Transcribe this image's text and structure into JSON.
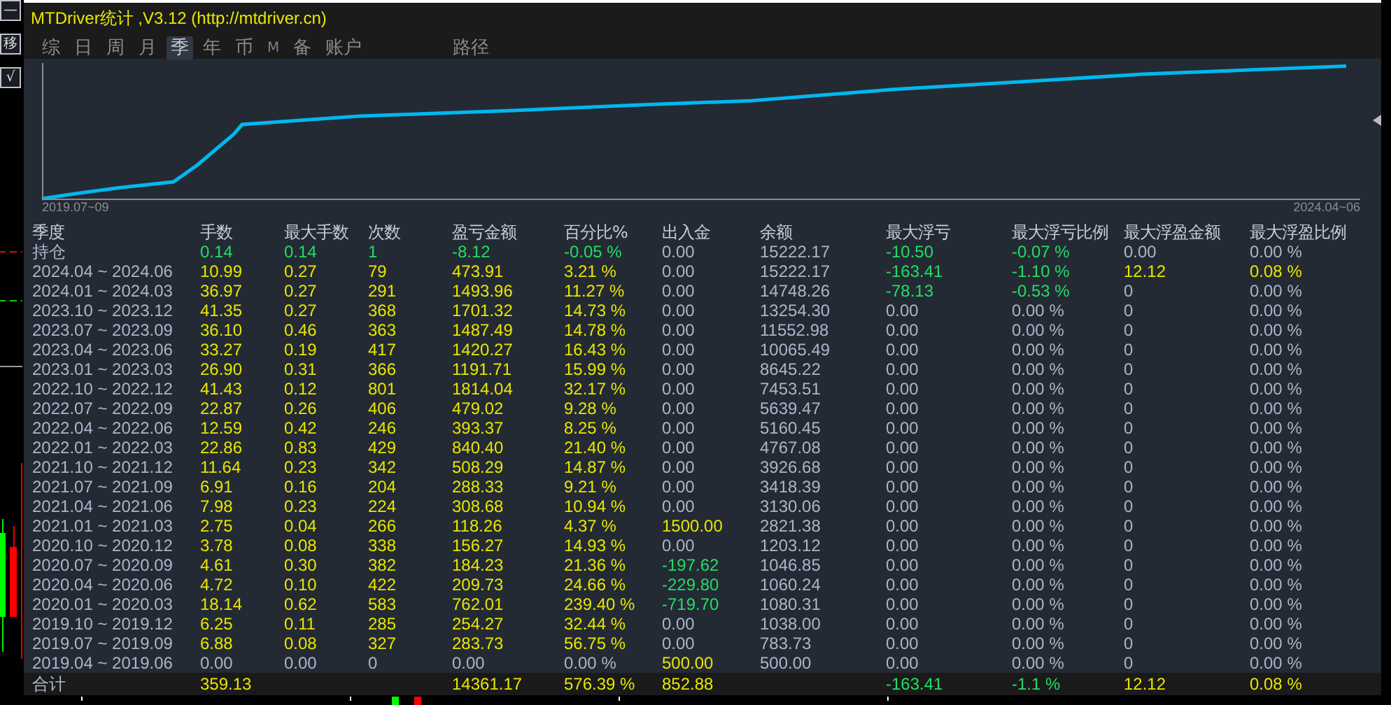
{
  "side_buttons": [
    "—",
    "移",
    "√"
  ],
  "window": {
    "title": "MTDriver统计 ,V3.12 (http://mtdriver.cn)"
  },
  "tabs": [
    {
      "label": "综",
      "selected": false
    },
    {
      "label": "日",
      "selected": false
    },
    {
      "label": "周",
      "selected": false
    },
    {
      "label": "月",
      "selected": false
    },
    {
      "label": "季",
      "selected": true
    },
    {
      "label": "年",
      "selected": false
    },
    {
      "label": "币",
      "selected": false
    },
    {
      "label": "M",
      "selected": false
    },
    {
      "label": "备",
      "selected": false
    },
    {
      "label": "账户",
      "selected": false
    },
    {
      "label": "路径",
      "selected": false
    }
  ],
  "equity_chart": {
    "start_label": "2019.07~09",
    "end_label": "2024.04~06"
  },
  "table": {
    "columns": [
      "季度",
      "手数",
      "最大手数",
      "次数",
      "盈亏金额",
      "百分比%",
      "出入金",
      "余额",
      "最大浮亏",
      "最大浮亏比例",
      "最大浮盈金额",
      "最大浮盈比例"
    ],
    "rows": [
      {
        "cells": [
          {
            "text": "持仓",
            "color": "#a9b6cc"
          },
          {
            "text": "0.14",
            "color": "#22dd66"
          },
          {
            "text": "0.14",
            "color": "#22dd66"
          },
          {
            "text": "1",
            "color": "#22dd66"
          },
          {
            "text": "-8.12",
            "color": "#22dd66"
          },
          {
            "text": "-0.05 %",
            "color": "#22dd66"
          },
          {
            "text": "0.00",
            "color": "#a9b6cc"
          },
          {
            "text": "15222.17",
            "color": "#a9b6cc"
          },
          {
            "text": "-10.50",
            "color": "#22dd66"
          },
          {
            "text": "-0.07 %",
            "color": "#22dd66"
          },
          {
            "text": "0.00",
            "color": "#a9b6cc"
          },
          {
            "text": "0.00 %",
            "color": "#a9b6cc"
          }
        ]
      },
      {
        "cells": [
          {
            "text": "2024.04 ~ 2024.06",
            "color": "#a9b6cc"
          },
          {
            "text": "10.99",
            "color": "#e6e600"
          },
          {
            "text": "0.27",
            "color": "#e6e600"
          },
          {
            "text": "79",
            "color": "#e6e600"
          },
          {
            "text": "473.91",
            "color": "#e6e600"
          },
          {
            "text": "3.21 %",
            "color": "#e6e600"
          },
          {
            "text": "0.00",
            "color": "#a9b6cc"
          },
          {
            "text": "15222.17",
            "color": "#a9b6cc"
          },
          {
            "text": "-163.41",
            "color": "#22dd66"
          },
          {
            "text": "-1.10 %",
            "color": "#22dd66"
          },
          {
            "text": "12.12",
            "color": "#e6e600"
          },
          {
            "text": "0.08 %",
            "color": "#e6e600"
          }
        ]
      },
      {
        "cells": [
          {
            "text": "2024.01 ~ 2024.03",
            "color": "#a9b6cc"
          },
          {
            "text": "36.97",
            "color": "#e6e600"
          },
          {
            "text": "0.27",
            "color": "#e6e600"
          },
          {
            "text": "291",
            "color": "#e6e600"
          },
          {
            "text": "1493.96",
            "color": "#e6e600"
          },
          {
            "text": "11.27 %",
            "color": "#e6e600"
          },
          {
            "text": "0.00",
            "color": "#a9b6cc"
          },
          {
            "text": "14748.26",
            "color": "#a9b6cc"
          },
          {
            "text": "-78.13",
            "color": "#22dd66"
          },
          {
            "text": "-0.53 %",
            "color": "#22dd66"
          },
          {
            "text": "0",
            "color": "#a9b6cc"
          },
          {
            "text": "0.00 %",
            "color": "#a9b6cc"
          }
        ]
      },
      {
        "cells": [
          {
            "text": "2023.10 ~ 2023.12",
            "color": "#a9b6cc"
          },
          {
            "text": "41.35",
            "color": "#e6e600"
          },
          {
            "text": "0.27",
            "color": "#e6e600"
          },
          {
            "text": "368",
            "color": "#e6e600"
          },
          {
            "text": "1701.32",
            "color": "#e6e600"
          },
          {
            "text": "14.73 %",
            "color": "#e6e600"
          },
          {
            "text": "0.00",
            "color": "#a9b6cc"
          },
          {
            "text": "13254.30",
            "color": "#a9b6cc"
          },
          {
            "text": "0.00",
            "color": "#a9b6cc"
          },
          {
            "text": "0.00 %",
            "color": "#a9b6cc"
          },
          {
            "text": "0",
            "color": "#a9b6cc"
          },
          {
            "text": "0.00 %",
            "color": "#a9b6cc"
          }
        ]
      },
      {
        "cells": [
          {
            "text": "2023.07 ~ 2023.09",
            "color": "#a9b6cc"
          },
          {
            "text": "36.10",
            "color": "#e6e600"
          },
          {
            "text": "0.46",
            "color": "#e6e600"
          },
          {
            "text": "363",
            "color": "#e6e600"
          },
          {
            "text": "1487.49",
            "color": "#e6e600"
          },
          {
            "text": "14.78 %",
            "color": "#e6e600"
          },
          {
            "text": "0.00",
            "color": "#a9b6cc"
          },
          {
            "text": "11552.98",
            "color": "#a9b6cc"
          },
          {
            "text": "0.00",
            "color": "#a9b6cc"
          },
          {
            "text": "0.00 %",
            "color": "#a9b6cc"
          },
          {
            "text": "0",
            "color": "#a9b6cc"
          },
          {
            "text": "0.00 %",
            "color": "#a9b6cc"
          }
        ]
      },
      {
        "cells": [
          {
            "text": "2023.04 ~ 2023.06",
            "color": "#a9b6cc"
          },
          {
            "text": "33.27",
            "color": "#e6e600"
          },
          {
            "text": "0.19",
            "color": "#e6e600"
          },
          {
            "text": "417",
            "color": "#e6e600"
          },
          {
            "text": "1420.27",
            "color": "#e6e600"
          },
          {
            "text": "16.43 %",
            "color": "#e6e600"
          },
          {
            "text": "0.00",
            "color": "#a9b6cc"
          },
          {
            "text": "10065.49",
            "color": "#a9b6cc"
          },
          {
            "text": "0.00",
            "color": "#a9b6cc"
          },
          {
            "text": "0.00 %",
            "color": "#a9b6cc"
          },
          {
            "text": "0",
            "color": "#a9b6cc"
          },
          {
            "text": "0.00 %",
            "color": "#a9b6cc"
          }
        ]
      },
      {
        "cells": [
          {
            "text": "2023.01 ~ 2023.03",
            "color": "#a9b6cc"
          },
          {
            "text": "26.90",
            "color": "#e6e600"
          },
          {
            "text": "0.31",
            "color": "#e6e600"
          },
          {
            "text": "366",
            "color": "#e6e600"
          },
          {
            "text": "1191.71",
            "color": "#e6e600"
          },
          {
            "text": "15.99 %",
            "color": "#e6e600"
          },
          {
            "text": "0.00",
            "color": "#a9b6cc"
          },
          {
            "text": "8645.22",
            "color": "#a9b6cc"
          },
          {
            "text": "0.00",
            "color": "#a9b6cc"
          },
          {
            "text": "0.00 %",
            "color": "#a9b6cc"
          },
          {
            "text": "0",
            "color": "#a9b6cc"
          },
          {
            "text": "0.00 %",
            "color": "#a9b6cc"
          }
        ]
      },
      {
        "cells": [
          {
            "text": "2022.10 ~ 2022.12",
            "color": "#a9b6cc"
          },
          {
            "text": "41.43",
            "color": "#e6e600"
          },
          {
            "text": "0.12",
            "color": "#e6e600"
          },
          {
            "text": "801",
            "color": "#e6e600"
          },
          {
            "text": "1814.04",
            "color": "#e6e600"
          },
          {
            "text": "32.17 %",
            "color": "#e6e600"
          },
          {
            "text": "0.00",
            "color": "#a9b6cc"
          },
          {
            "text": "7453.51",
            "color": "#a9b6cc"
          },
          {
            "text": "0.00",
            "color": "#a9b6cc"
          },
          {
            "text": "0.00 %",
            "color": "#a9b6cc"
          },
          {
            "text": "0",
            "color": "#a9b6cc"
          },
          {
            "text": "0.00 %",
            "color": "#a9b6cc"
          }
        ]
      },
      {
        "cells": [
          {
            "text": "2022.07 ~ 2022.09",
            "color": "#a9b6cc"
          },
          {
            "text": "22.87",
            "color": "#e6e600"
          },
          {
            "text": "0.26",
            "color": "#e6e600"
          },
          {
            "text": "406",
            "color": "#e6e600"
          },
          {
            "text": "479.02",
            "color": "#e6e600"
          },
          {
            "text": "9.28 %",
            "color": "#e6e600"
          },
          {
            "text": "0.00",
            "color": "#a9b6cc"
          },
          {
            "text": "5639.47",
            "color": "#a9b6cc"
          },
          {
            "text": "0.00",
            "color": "#a9b6cc"
          },
          {
            "text": "0.00 %",
            "color": "#a9b6cc"
          },
          {
            "text": "0",
            "color": "#a9b6cc"
          },
          {
            "text": "0.00 %",
            "color": "#a9b6cc"
          }
        ]
      },
      {
        "cells": [
          {
            "text": "2022.04 ~ 2022.06",
            "color": "#a9b6cc"
          },
          {
            "text": "12.59",
            "color": "#e6e600"
          },
          {
            "text": "0.42",
            "color": "#e6e600"
          },
          {
            "text": "246",
            "color": "#e6e600"
          },
          {
            "text": "393.37",
            "color": "#e6e600"
          },
          {
            "text": "8.25 %",
            "color": "#e6e600"
          },
          {
            "text": "0.00",
            "color": "#a9b6cc"
          },
          {
            "text": "5160.45",
            "color": "#a9b6cc"
          },
          {
            "text": "0.00",
            "color": "#a9b6cc"
          },
          {
            "text": "0.00 %",
            "color": "#a9b6cc"
          },
          {
            "text": "0",
            "color": "#a9b6cc"
          },
          {
            "text": "0.00 %",
            "color": "#a9b6cc"
          }
        ]
      },
      {
        "cells": [
          {
            "text": "2022.01 ~ 2022.03",
            "color": "#a9b6cc"
          },
          {
            "text": "22.86",
            "color": "#e6e600"
          },
          {
            "text": "0.83",
            "color": "#e6e600"
          },
          {
            "text": "429",
            "color": "#e6e600"
          },
          {
            "text": "840.40",
            "color": "#e6e600"
          },
          {
            "text": "21.40 %",
            "color": "#e6e600"
          },
          {
            "text": "0.00",
            "color": "#a9b6cc"
          },
          {
            "text": "4767.08",
            "color": "#a9b6cc"
          },
          {
            "text": "0.00",
            "color": "#a9b6cc"
          },
          {
            "text": "0.00 %",
            "color": "#a9b6cc"
          },
          {
            "text": "0",
            "color": "#a9b6cc"
          },
          {
            "text": "0.00 %",
            "color": "#a9b6cc"
          }
        ]
      },
      {
        "cells": [
          {
            "text": "2021.10 ~ 2021.12",
            "color": "#a9b6cc"
          },
          {
            "text": "11.64",
            "color": "#e6e600"
          },
          {
            "text": "0.23",
            "color": "#e6e600"
          },
          {
            "text": "342",
            "color": "#e6e600"
          },
          {
            "text": "508.29",
            "color": "#e6e600"
          },
          {
            "text": "14.87 %",
            "color": "#e6e600"
          },
          {
            "text": "0.00",
            "color": "#a9b6cc"
          },
          {
            "text": "3926.68",
            "color": "#a9b6cc"
          },
          {
            "text": "0.00",
            "color": "#a9b6cc"
          },
          {
            "text": "0.00 %",
            "color": "#a9b6cc"
          },
          {
            "text": "0",
            "color": "#a9b6cc"
          },
          {
            "text": "0.00 %",
            "color": "#a9b6cc"
          }
        ]
      },
      {
        "cells": [
          {
            "text": "2021.07 ~ 2021.09",
            "color": "#a9b6cc"
          },
          {
            "text": "6.91",
            "color": "#e6e600"
          },
          {
            "text": "0.16",
            "color": "#e6e600"
          },
          {
            "text": "204",
            "color": "#e6e600"
          },
          {
            "text": "288.33",
            "color": "#e6e600"
          },
          {
            "text": "9.21 %",
            "color": "#e6e600"
          },
          {
            "text": "0.00",
            "color": "#a9b6cc"
          },
          {
            "text": "3418.39",
            "color": "#a9b6cc"
          },
          {
            "text": "0.00",
            "color": "#a9b6cc"
          },
          {
            "text": "0.00 %",
            "color": "#a9b6cc"
          },
          {
            "text": "0",
            "color": "#a9b6cc"
          },
          {
            "text": "0.00 %",
            "color": "#a9b6cc"
          }
        ]
      },
      {
        "cells": [
          {
            "text": "2021.04 ~ 2021.06",
            "color": "#a9b6cc"
          },
          {
            "text": "7.98",
            "color": "#e6e600"
          },
          {
            "text": "0.23",
            "color": "#e6e600"
          },
          {
            "text": "224",
            "color": "#e6e600"
          },
          {
            "text": "308.68",
            "color": "#e6e600"
          },
          {
            "text": "10.94 %",
            "color": "#e6e600"
          },
          {
            "text": "0.00",
            "color": "#a9b6cc"
          },
          {
            "text": "3130.06",
            "color": "#a9b6cc"
          },
          {
            "text": "0.00",
            "color": "#a9b6cc"
          },
          {
            "text": "0.00 %",
            "color": "#a9b6cc"
          },
          {
            "text": "0",
            "color": "#a9b6cc"
          },
          {
            "text": "0.00 %",
            "color": "#a9b6cc"
          }
        ]
      },
      {
        "cells": [
          {
            "text": "2021.01 ~ 2021.03",
            "color": "#a9b6cc"
          },
          {
            "text": "2.75",
            "color": "#e6e600"
          },
          {
            "text": "0.04",
            "color": "#e6e600"
          },
          {
            "text": "266",
            "color": "#e6e600"
          },
          {
            "text": "118.26",
            "color": "#e6e600"
          },
          {
            "text": "4.37 %",
            "color": "#e6e600"
          },
          {
            "text": "1500.00",
            "color": "#e6e600"
          },
          {
            "text": "2821.38",
            "color": "#a9b6cc"
          },
          {
            "text": "0.00",
            "color": "#a9b6cc"
          },
          {
            "text": "0.00 %",
            "color": "#a9b6cc"
          },
          {
            "text": "0",
            "color": "#a9b6cc"
          },
          {
            "text": "0.00 %",
            "color": "#a9b6cc"
          }
        ]
      },
      {
        "cells": [
          {
            "text": "2020.10 ~ 2020.12",
            "color": "#a9b6cc"
          },
          {
            "text": "3.78",
            "color": "#e6e600"
          },
          {
            "text": "0.08",
            "color": "#e6e600"
          },
          {
            "text": "338",
            "color": "#e6e600"
          },
          {
            "text": "156.27",
            "color": "#e6e600"
          },
          {
            "text": "14.93 %",
            "color": "#e6e600"
          },
          {
            "text": "0.00",
            "color": "#a9b6cc"
          },
          {
            "text": "1203.12",
            "color": "#a9b6cc"
          },
          {
            "text": "0.00",
            "color": "#a9b6cc"
          },
          {
            "text": "0.00 %",
            "color": "#a9b6cc"
          },
          {
            "text": "0",
            "color": "#a9b6cc"
          },
          {
            "text": "0.00 %",
            "color": "#a9b6cc"
          }
        ]
      },
      {
        "cells": [
          {
            "text": "2020.07 ~ 2020.09",
            "color": "#a9b6cc"
          },
          {
            "text": "4.61",
            "color": "#e6e600"
          },
          {
            "text": "0.30",
            "color": "#e6e600"
          },
          {
            "text": "382",
            "color": "#e6e600"
          },
          {
            "text": "184.23",
            "color": "#e6e600"
          },
          {
            "text": "21.36 %",
            "color": "#e6e600"
          },
          {
            "text": "-197.62",
            "color": "#22dd66"
          },
          {
            "text": "1046.85",
            "color": "#a9b6cc"
          },
          {
            "text": "0.00",
            "color": "#a9b6cc"
          },
          {
            "text": "0.00 %",
            "color": "#a9b6cc"
          },
          {
            "text": "0",
            "color": "#a9b6cc"
          },
          {
            "text": "0.00 %",
            "color": "#a9b6cc"
          }
        ]
      },
      {
        "cells": [
          {
            "text": "2020.04 ~ 2020.06",
            "color": "#a9b6cc"
          },
          {
            "text": "4.72",
            "color": "#e6e600"
          },
          {
            "text": "0.10",
            "color": "#e6e600"
          },
          {
            "text": "422",
            "color": "#e6e600"
          },
          {
            "text": "209.73",
            "color": "#e6e600"
          },
          {
            "text": "24.66 %",
            "color": "#e6e600"
          },
          {
            "text": "-229.80",
            "color": "#22dd66"
          },
          {
            "text": "1060.24",
            "color": "#a9b6cc"
          },
          {
            "text": "0.00",
            "color": "#a9b6cc"
          },
          {
            "text": "0.00 %",
            "color": "#a9b6cc"
          },
          {
            "text": "0",
            "color": "#a9b6cc"
          },
          {
            "text": "0.00 %",
            "color": "#a9b6cc"
          }
        ]
      },
      {
        "cells": [
          {
            "text": "2020.01 ~ 2020.03",
            "color": "#a9b6cc"
          },
          {
            "text": "18.14",
            "color": "#e6e600"
          },
          {
            "text": "0.62",
            "color": "#e6e600"
          },
          {
            "text": "583",
            "color": "#e6e600"
          },
          {
            "text": "762.01",
            "color": "#e6e600"
          },
          {
            "text": "239.40 %",
            "color": "#e6e600"
          },
          {
            "text": "-719.70",
            "color": "#22dd66"
          },
          {
            "text": "1080.31",
            "color": "#a9b6cc"
          },
          {
            "text": "0.00",
            "color": "#a9b6cc"
          },
          {
            "text": "0.00 %",
            "color": "#a9b6cc"
          },
          {
            "text": "0",
            "color": "#a9b6cc"
          },
          {
            "text": "0.00 %",
            "color": "#a9b6cc"
          }
        ]
      },
      {
        "cells": [
          {
            "text": "2019.10 ~ 2019.12",
            "color": "#a9b6cc"
          },
          {
            "text": "6.25",
            "color": "#e6e600"
          },
          {
            "text": "0.11",
            "color": "#e6e600"
          },
          {
            "text": "285",
            "color": "#e6e600"
          },
          {
            "text": "254.27",
            "color": "#e6e600"
          },
          {
            "text": "32.44 %",
            "color": "#e6e600"
          },
          {
            "text": "0.00",
            "color": "#a9b6cc"
          },
          {
            "text": "1038.00",
            "color": "#a9b6cc"
          },
          {
            "text": "0.00",
            "color": "#a9b6cc"
          },
          {
            "text": "0.00 %",
            "color": "#a9b6cc"
          },
          {
            "text": "0",
            "color": "#a9b6cc"
          },
          {
            "text": "0.00 %",
            "color": "#a9b6cc"
          }
        ]
      },
      {
        "cells": [
          {
            "text": "2019.07 ~ 2019.09",
            "color": "#a9b6cc"
          },
          {
            "text": "6.88",
            "color": "#e6e600"
          },
          {
            "text": "0.08",
            "color": "#e6e600"
          },
          {
            "text": "327",
            "color": "#e6e600"
          },
          {
            "text": "283.73",
            "color": "#e6e600"
          },
          {
            "text": "56.75 %",
            "color": "#e6e600"
          },
          {
            "text": "0.00",
            "color": "#a9b6cc"
          },
          {
            "text": "783.73",
            "color": "#a9b6cc"
          },
          {
            "text": "0.00",
            "color": "#a9b6cc"
          },
          {
            "text": "0.00 %",
            "color": "#a9b6cc"
          },
          {
            "text": "0",
            "color": "#a9b6cc"
          },
          {
            "text": "0.00 %",
            "color": "#a9b6cc"
          }
        ]
      },
      {
        "cells": [
          {
            "text": "2019.04 ~ 2019.06",
            "color": "#a9b6cc"
          },
          {
            "text": "0.00",
            "color": "#a9b6cc"
          },
          {
            "text": "0.00",
            "color": "#a9b6cc"
          },
          {
            "text": "0",
            "color": "#a9b6cc"
          },
          {
            "text": "0.00",
            "color": "#a9b6cc"
          },
          {
            "text": "0.00 %",
            "color": "#a9b6cc"
          },
          {
            "text": "500.00",
            "color": "#e6e600"
          },
          {
            "text": "500.00",
            "color": "#a9b6cc"
          },
          {
            "text": "0.00",
            "color": "#a9b6cc"
          },
          {
            "text": "0.00 %",
            "color": "#a9b6cc"
          },
          {
            "text": "0",
            "color": "#a9b6cc"
          },
          {
            "text": "0.00 %",
            "color": "#a9b6cc"
          }
        ]
      }
    ],
    "total": {
      "label": {
        "text": "合计",
        "color": "#a9b6cc"
      },
      "lots": {
        "text": "359.13",
        "color": "#e6e600"
      },
      "profit": {
        "text": "14361.17",
        "color": "#e6e600"
      },
      "percent": {
        "text": "576.39 %",
        "color": "#e6e600"
      },
      "deposit": {
        "text": "852.88",
        "color": "#e6e600"
      },
      "max_float_loss": {
        "text": "-163.41",
        "color": "#22dd66"
      },
      "max_float_loss_pct": {
        "text": "-1.1 %",
        "color": "#22dd66"
      },
      "max_float_profit": {
        "text": "12.12",
        "color": "#e6e600"
      },
      "max_float_profit_pct": {
        "text": "0.08 %",
        "color": "#e6e600"
      }
    }
  }
}
